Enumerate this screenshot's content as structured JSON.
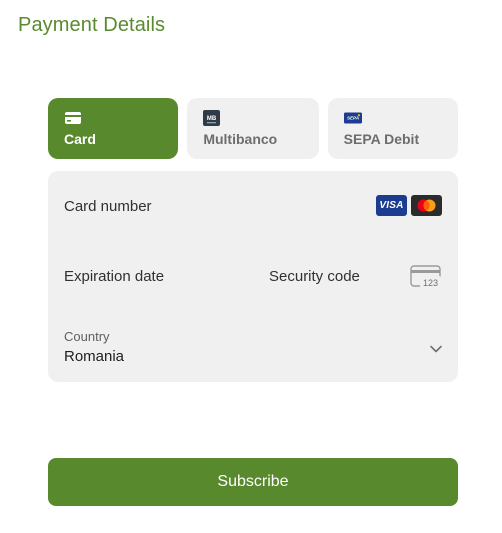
{
  "header": {
    "title": "Payment Details"
  },
  "payment_methods": [
    {
      "label": "Card",
      "icon": "card-icon",
      "selected": true
    },
    {
      "label": "Multibanco",
      "icon": "multibanco-logo-icon",
      "selected": false,
      "icon_text": "MB"
    },
    {
      "label": "SEPA Debit",
      "icon": "sepa-logo-icon",
      "selected": false,
      "icon_text": "SEPA"
    }
  ],
  "card_form": {
    "card_number_label": "Card number",
    "expiration_label": "Expiration date",
    "security_code_label": "Security code",
    "cvc_icon_text": "123",
    "brands": [
      "visa-icon",
      "mastercard-icon"
    ],
    "visa_text": "VISA",
    "country": {
      "label": "Country",
      "value": "Romania"
    }
  },
  "actions": {
    "subscribe_label": "Subscribe"
  },
  "colors": {
    "accent": "#588a2d",
    "title": "#5a8a2f",
    "field_background": "#f0f0f0"
  }
}
